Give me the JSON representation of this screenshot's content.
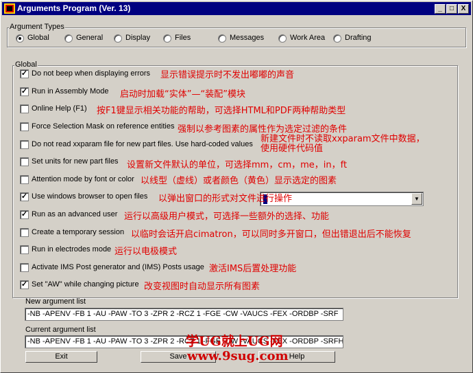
{
  "window": {
    "title": "Arguments Program (Ver. 13)",
    "controls": {
      "minimize": "_",
      "maximize": "□",
      "close": "X"
    }
  },
  "argument_types": {
    "label": "Argument Types",
    "options": [
      "Global",
      "General",
      "Display",
      "Files",
      "Messages",
      "Work Area",
      "Drafting"
    ],
    "selected": "Global"
  },
  "global": {
    "label": "Global",
    "options": [
      {
        "label": "Do not beep when displaying errors",
        "checked": true,
        "note": "显示错误提示时不发出嘟嘟的声音"
      },
      {
        "label": "Run in Assembly Mode",
        "checked": true,
        "note": "启动时加载“实体”—“装配”模块"
      },
      {
        "label": "Online Help (F1)",
        "checked": false,
        "note": "按F1键显示相关功能的帮助，可选择HTML和PDF两种帮助类型"
      },
      {
        "label": "Force Selection Mask on reference entities",
        "checked": false,
        "note": "强制以参考图素的属性作为选定过滤的条件"
      },
      {
        "label": "Do not read xxparam file for new part files. Use hard-coded values",
        "checked": false,
        "note": "新建文件时不读取xxparam文件中数据，",
        "note_line2": "使用硬件代码值"
      },
      {
        "label": "Set units for new part files",
        "checked": false,
        "note": "设置新文件默认的单位，可选择mm，cm，me，in，ft"
      },
      {
        "label": "Attention mode by font or color",
        "checked": false,
        "note": "以线型（虚线）或者颜色（黄色）显示选定的图素"
      },
      {
        "label": "Use windows browser to open files",
        "checked": true,
        "note": "以弹出窗口的形式对文件进行操作"
      },
      {
        "label": "Run as an advanced user",
        "checked": true,
        "note": "运行以高级用户模式，可选择一些额外的选择、功能"
      },
      {
        "label": "Create a temporary session",
        "checked": false,
        "note": "以临时会话开启cimatron，可以同时多开窗口，但出错退出后不能恢复"
      },
      {
        "label": "Run in electrodes mode",
        "checked": false,
        "note": "运行以电极模式"
      },
      {
        "label": "Activate IMS Post generator and (IMS) Posts usage",
        "checked": false,
        "note": "激活IMS后置处理功能"
      },
      {
        "label": "Set \"AW\" while changing picture",
        "checked": true,
        "note": "改变视图时自动显示所有图素"
      }
    ]
  },
  "new_argument_list": {
    "label": "New argument list",
    "value": "-NB  -APENV  -FB 1  -AU  -PAW  -TO 3  -ZPR 2  -RCZ 1  -FGE  -CW  -VAUCS  -FEX  -ORDBP  -SRF"
  },
  "current_argument_list": {
    "label": "Current argument list",
    "value": "-NB -APENV -FB 1 -AU -PAW -TO 3 -ZPR 2 -RCZ 1 -FGE -CW -VAUCS -FEX -ORDBP -SRFHDL"
  },
  "buttons": {
    "exit": "Exit",
    "save": "Save",
    "help": "Help"
  },
  "watermark": {
    "line1": "学UG就上UG网",
    "line2": "www.9sug.com"
  }
}
